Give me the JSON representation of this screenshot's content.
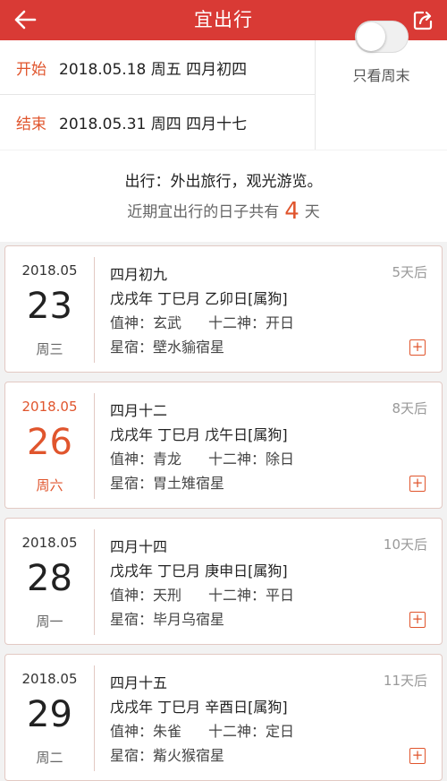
{
  "header": {
    "title": "宜出行"
  },
  "range": {
    "start_label": "开始",
    "start_value": "2018.05.18 周五 四月初四",
    "end_label": "结束",
    "end_value": "2018.05.31 周四 四月十七",
    "weekend_only_label": "只看周末",
    "weekend_only": false
  },
  "summary": {
    "activity": "出行：外出旅行，观光游览。",
    "prefix": "近期宜出行的日子共有",
    "count": "4",
    "suffix": "天"
  },
  "days": [
    {
      "ym": "2018.05",
      "day": "23",
      "weekday": "周三",
      "lunar": "四月初九",
      "ganzhi": "戊戌年 丁巳月 乙卯日[属狗]",
      "zhishen_label": "值神：",
      "zhishen": "玄武",
      "shier_label": "十二神：",
      "shier": "开日",
      "xingxiu_label": "星宿：",
      "xingxiu": "壁水貐宿星",
      "from_now": "5天后",
      "highlight": false,
      "plus": "+"
    },
    {
      "ym": "2018.05",
      "day": "26",
      "weekday": "周六",
      "lunar": "四月十二",
      "ganzhi": "戊戌年 丁巳月 戊午日[属狗]",
      "zhishen_label": "值神：",
      "zhishen": "青龙",
      "shier_label": "十二神：",
      "shier": "除日",
      "xingxiu_label": "星宿：",
      "xingxiu": "胃土雉宿星",
      "from_now": "8天后",
      "highlight": true,
      "plus": "+"
    },
    {
      "ym": "2018.05",
      "day": "28",
      "weekday": "周一",
      "lunar": "四月十四",
      "ganzhi": "戊戌年 丁巳月 庚申日[属狗]",
      "zhishen_label": "值神：",
      "zhishen": "天刑",
      "shier_label": "十二神：",
      "shier": "平日",
      "xingxiu_label": "星宿：",
      "xingxiu": "毕月乌宿星",
      "from_now": "10天后",
      "highlight": false,
      "plus": "+"
    },
    {
      "ym": "2018.05",
      "day": "29",
      "weekday": "周二",
      "lunar": "四月十五",
      "ganzhi": "戊戌年 丁巳月 辛酉日[属狗]",
      "zhishen_label": "值神：",
      "zhishen": "朱雀",
      "shier_label": "十二神：",
      "shier": "定日",
      "xingxiu_label": "星宿：",
      "xingxiu": "觜火猴宿星",
      "from_now": "11天后",
      "highlight": false,
      "plus": "+"
    }
  ],
  "colors": {
    "header_bg": "#d93a35",
    "accent": "#e0552d"
  }
}
